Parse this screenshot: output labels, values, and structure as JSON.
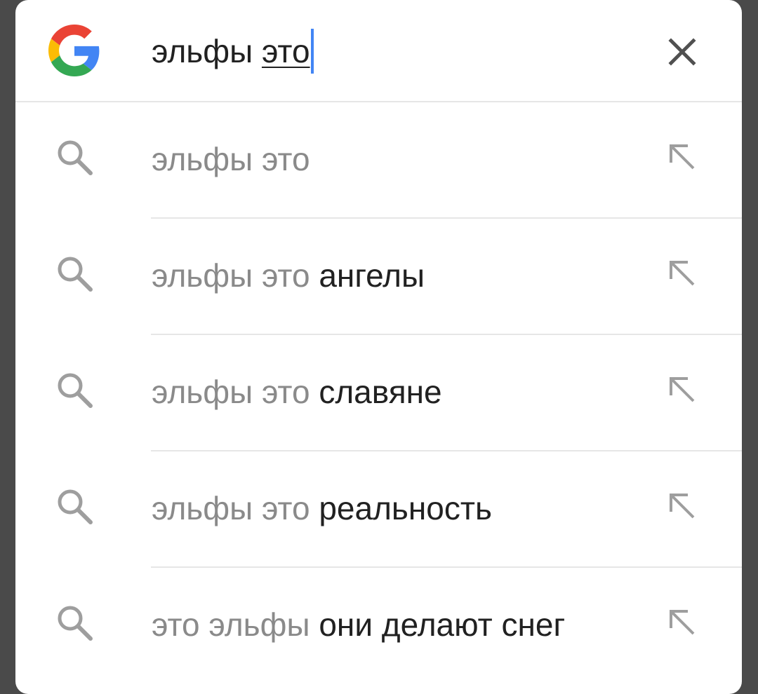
{
  "search_bar": {
    "query_prefix": "эльфы ",
    "query_composing": "это",
    "logo_icon": "google-g-icon",
    "clear_icon": "close-icon",
    "caret_color": "#4285f4"
  },
  "suggestions": [
    {
      "base": "эльфы это",
      "completion": "",
      "icon": "search-icon",
      "action_icon": "arrow-up-left-icon"
    },
    {
      "base": "эльфы это ",
      "completion": "ангелы",
      "icon": "search-icon",
      "action_icon": "arrow-up-left-icon"
    },
    {
      "base": "эльфы это ",
      "completion": "славяне",
      "icon": "search-icon",
      "action_icon": "arrow-up-left-icon"
    },
    {
      "base": "эльфы это ",
      "completion": "реальность",
      "icon": "search-icon",
      "action_icon": "arrow-up-left-icon"
    },
    {
      "base": "это эльфы ",
      "completion": "они делают снег",
      "icon": "search-icon",
      "action_icon": "arrow-up-left-icon"
    }
  ],
  "colors": {
    "muted_text": "#8a8a8a",
    "primary_text": "#212121",
    "divider": "#e6e6e6"
  }
}
